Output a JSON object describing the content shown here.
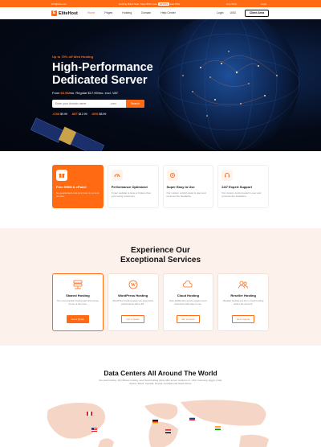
{
  "topbar": {
    "email": "info@site.com",
    "promo_prefix": "Hosting Black Sale: Save 80% code",
    "promo_code": "BF2024",
    "promo_suffix": "Get Offer",
    "chat": "Live Chat",
    "login": "Login"
  },
  "header": {
    "logo_text": "EliteHost",
    "nav": [
      "Home",
      "Pages",
      "Hosting",
      "Domain",
      "Help Center"
    ],
    "login": "Login",
    "currency": "USD",
    "client_button": "Client Area"
  },
  "hero": {
    "eyebrow": "Up to 75% off Web Hosting",
    "title": "High-Performance Dedicated Server",
    "price_prefix": "From",
    "price_value": "$3.95",
    "price_suffix": "/mo. Regular $17.99/mo. excl. VAT",
    "search_placeholder": "Enter your domain name",
    "search_tld": ".com",
    "search_button": "Search",
    "tlds": [
      {
        "ext": ".COM",
        "price": "$9.99"
      },
      {
        "ext": ".NET",
        "price": "$12.99"
      },
      {
        "ext": ".ORG",
        "price": "$8.99"
      }
    ]
  },
  "features": [
    {
      "title": "Free SRIM & cPanel",
      "desc": "No guaranteed cost lock forex in current domain."
    },
    {
      "title": "Performance Optimized",
      "desc": "If your website is slow or broken then your losing customers."
    },
    {
      "title": "Super Easy to Use",
      "desc": "Our custom control panel is user and removes the headache."
    },
    {
      "title": "24/7 Expert Support",
      "desc": "Our custom control panel is user and removes the headache."
    }
  ],
  "experience": {
    "title_line1": "Experience Our",
    "title_line2": "Exceptional Services",
    "cards": [
      {
        "title": "Shared Hosting",
        "desc": "The most popular hosting plan and comes at one of the most.",
        "button": "Get a Quote"
      },
      {
        "title": "WordPress Hosting",
        "desc": "WordPress Hosting gives you speed and performance with a full.",
        "button": "Get a Quote"
      },
      {
        "title": "Cloud Hosting",
        "desc": "Gain additional resource support your customers with easy to use.",
        "button": "Get a Quote"
      },
      {
        "title": "Reseller Hosting",
        "desc": "Reseller hosting is a form of web hosting where the account.",
        "button": "Get a Quote"
      }
    ]
  },
  "datacenters": {
    "title": "Data Centers All Around The World",
    "desc": "Our web hosting, WordPress hosting, and cloud hosting plans offer server locations in: USA, Germany, Egypt, India, Ghana, Brazil, Canada, Russia, Australia and South Africa."
  },
  "colors": {
    "accent": "#ff6a13",
    "hero_bg": "#050a18",
    "section_bg": "#fdf1ec"
  }
}
